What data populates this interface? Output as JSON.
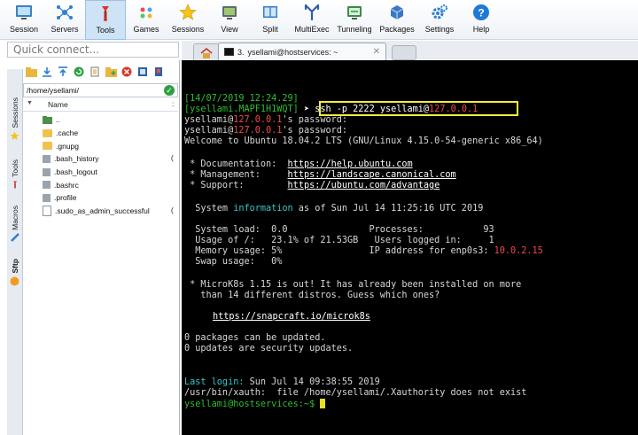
{
  "toolbar": {
    "items": [
      {
        "label": "Session",
        "icon": "session-icon"
      },
      {
        "label": "Servers",
        "icon": "servers-icon"
      },
      {
        "label": "Tools",
        "icon": "tools-icon"
      },
      {
        "label": "Games",
        "icon": "games-icon"
      },
      {
        "label": "Sessions",
        "icon": "star-icon"
      },
      {
        "label": "View",
        "icon": "view-icon"
      },
      {
        "label": "Split",
        "icon": "split-icon"
      },
      {
        "label": "MultiExec",
        "icon": "multiexec-icon"
      },
      {
        "label": "Tunneling",
        "icon": "tunneling-icon"
      },
      {
        "label": "Packages",
        "icon": "packages-icon"
      },
      {
        "label": "Settings",
        "icon": "gear-icon"
      },
      {
        "label": "Help",
        "icon": "help-icon"
      }
    ]
  },
  "quick_connect": {
    "placeholder": "Quick connect..."
  },
  "tabs": {
    "terminal_tab": {
      "number": "3.",
      "label": "ysellami@hostservices: ~"
    }
  },
  "side_tabs": [
    "Sessions",
    "Tools",
    "Macros",
    "Sftp"
  ],
  "browser": {
    "path": "/home/ysellami/",
    "column_name": "Name",
    "files": [
      {
        "name": "..",
        "type": "parent",
        "size": ""
      },
      {
        "name": ".cache",
        "type": "folder",
        "size": ""
      },
      {
        "name": ".gnupg",
        "type": "folder",
        "size": ""
      },
      {
        "name": ".bash_history",
        "type": "file-dark",
        "size": "("
      },
      {
        "name": ".bash_logout",
        "type": "file-dark",
        "size": ""
      },
      {
        "name": ".bashrc",
        "type": "file-dark",
        "size": ""
      },
      {
        "name": ".profile",
        "type": "file-dark",
        "size": ""
      },
      {
        "name": ".sudo_as_admin_successful",
        "type": "file",
        "size": "("
      }
    ]
  },
  "terminal": {
    "timestamp": "[14/07/2019 12:24.29]",
    "local_prompt": "[ysellami.MAPF1H1WQT]",
    "arrow": "➤",
    "command": "ssh -p 2222 ysellami@",
    "command_host": "127.0.0.1",
    "pw_user": "ysellami@",
    "pw_host": "127.0.0.1",
    "pw_suffix": "'s password:",
    "welcome": "Welcome to Ubuntu 18.04.2 LTS (GNU/Linux 4.15.0-54-generic x86_64)",
    "doc_label": " * Documentation:  ",
    "doc_url": "https://help.ubuntu.com",
    "mgmt_label": " * Management:     ",
    "mgmt_url": "https://landscape.canonical.com",
    "support_label": " * Support:        ",
    "support_url": "https://ubuntu.com/advantage",
    "sysinfo_pre": "  System ",
    "sysinfo_word": "information",
    "sysinfo_post": " as of Sun Jul 14 11:25:16 UTC 2019",
    "load_line": "  System load:  0.0               Processes:           93",
    "usage_line": "  Usage of /:   23.1% of 21.53GB   Users logged in:     1",
    "memory_line": "  Memory usage: 5%                IP address for enp0s3: ",
    "ip_address": "10.0.2.15",
    "swap_line": "  Swap usage:   0%",
    "microk8s_1": " * MicroK8s 1.15 is out! It has already been installed on more",
    "microk8s_2": "   than 14 different distros. Guess which ones?",
    "snap_url": "https://snapcraft.io/microk8s",
    "updates_1": "0 packages can be updated.",
    "updates_2": "0 updates are security updates.",
    "last_login_label": "Last login:",
    "last_login_value": " Sun Jul 14 09:38:55 2019",
    "xauth": "/usr/bin/xauth:  file /home/ysellami/.Xauthority does not exist",
    "prompt": "ysellami@hostservices:~$ "
  },
  "colors": {
    "terminal_bg": "#000000",
    "prompt_green": "#2fbf2f",
    "host_red": "#ef4a4a",
    "info_cyan": "#33c7c7",
    "highlight_yellow": "#f2ec3a"
  }
}
